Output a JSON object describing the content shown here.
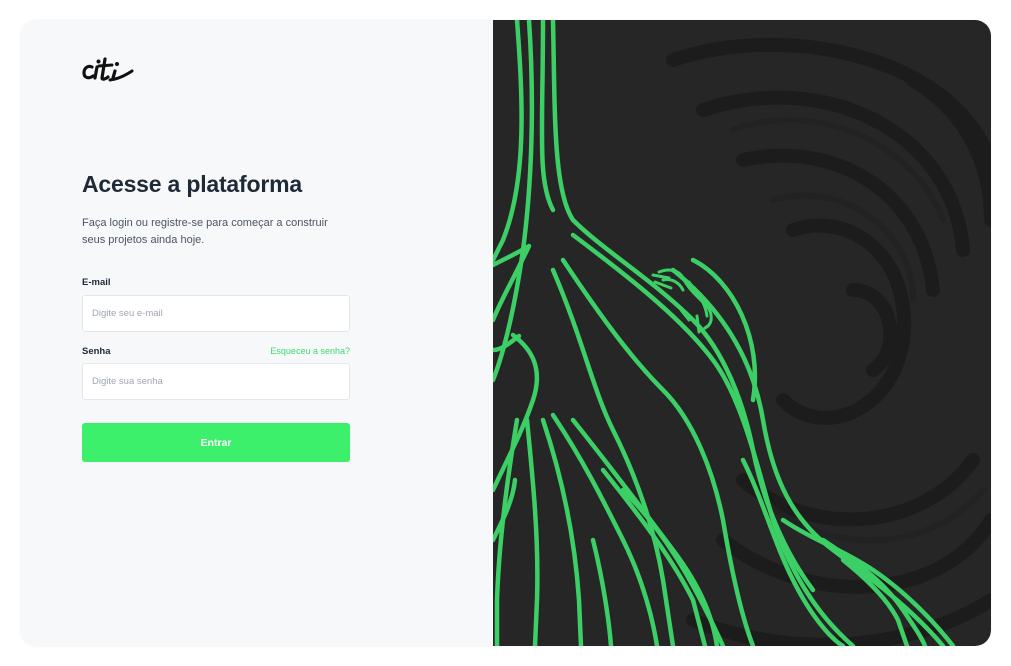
{
  "brand": {
    "logo_text": "citi"
  },
  "heading": {
    "title": "Acesse a plataforma",
    "subtitle": "Faça login ou registre-se para começar a construir seus projetos ainda hoje."
  },
  "form": {
    "email_label": "E-mail",
    "email_placeholder": "Digite seu e-mail",
    "password_label": "Senha",
    "password_placeholder": "Digite sua senha",
    "forgot_label": "Esqueceu a senha?",
    "submit_label": "Entrar"
  },
  "colors": {
    "accent": "#3df06c",
    "dark_panel": "#262626",
    "text": "#1f2a37"
  },
  "illustration": {
    "icons": [
      "roots-illustration",
      "ant-icon"
    ]
  }
}
